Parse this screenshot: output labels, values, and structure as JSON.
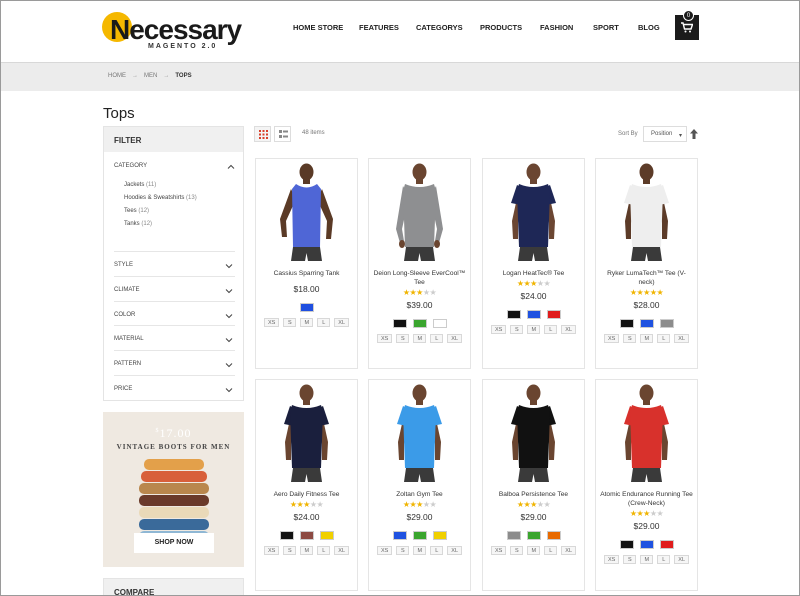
{
  "brand": {
    "logo_text": "Necessary",
    "logo_sub": "MAGENTO 2.0"
  },
  "nav": [
    "HOME STORE",
    "FEATURES",
    "CATEGORYS",
    "PRODUCTS",
    "FASHION",
    "SPORT",
    "BLOG"
  ],
  "cart": {
    "count": "0"
  },
  "breadcrumb": {
    "items": [
      "HOME",
      "MEN"
    ],
    "current": "TOPS"
  },
  "page": {
    "title": "Tops"
  },
  "filter": {
    "title": "FILTER",
    "category_label": "CATEGORY",
    "categories": [
      {
        "label": "Jackets",
        "count": "(11)"
      },
      {
        "label": "Hoodies & Sweatshirts",
        "count": "(13)"
      },
      {
        "label": "Tees",
        "count": "(12)"
      },
      {
        "label": "Tanks",
        "count": "(12)"
      }
    ],
    "sections": [
      "STYLE",
      "CLIMATE",
      "COLOR",
      "MATERIAL",
      "PATTERN",
      "PRICE"
    ]
  },
  "banner": {
    "price_symbol": "$",
    "price": "17.00",
    "tagline": "VINTAGE BOOTS FOR MEN",
    "button": "SHOP NOW"
  },
  "compare": {
    "title": "COMPARE"
  },
  "toolbar": {
    "items": "48 items",
    "sort_label": "Sort By",
    "sort_value": "Position"
  },
  "products": [
    {
      "name": "Cassius Sparring Tank",
      "rating": 0,
      "price": "$18.00",
      "colors": [
        "#1f4fe0"
      ],
      "sizes": [
        "XS",
        "S",
        "M",
        "L",
        "XL"
      ],
      "shirt": "#4f66d6",
      "sleeve": "tank",
      "skin": "#5a3a26"
    },
    {
      "name": "Deion Long-Sleeve EverCool™ Tee",
      "rating": 3,
      "price": "$39.00",
      "colors": [
        "#111111",
        "#3aa52e",
        "#ffffff"
      ],
      "sizes": [
        "XS",
        "S",
        "M",
        "L",
        "XL"
      ],
      "shirt": "#8e8f91",
      "sleeve": "long",
      "skin": "#6a4530"
    },
    {
      "name": "Logan HeatTec® Tee",
      "rating": 3,
      "price": "$24.00",
      "colors": [
        "#111111",
        "#1f52e0",
        "#e01c1c"
      ],
      "sizes": [
        "XS",
        "S",
        "M",
        "L",
        "XL"
      ],
      "shirt": "#1e2756",
      "sleeve": "short",
      "skin": "#6b4632"
    },
    {
      "name": "Ryker LumaTech™ Tee (V-neck)",
      "rating": 5,
      "price": "$28.00",
      "colors": [
        "#111111",
        "#1f52e0",
        "#8c8c8c"
      ],
      "sizes": [
        "XS",
        "S",
        "M",
        "L",
        "XL"
      ],
      "shirt": "#eeeeee",
      "sleeve": "short",
      "skin": "#5c3b28"
    },
    {
      "name": "Aero Daily Fitness Tee",
      "rating": 3,
      "price": "$24.00",
      "colors": [
        "#111111",
        "#8c4a42",
        "#f0d000"
      ],
      "sizes": [
        "XS",
        "S",
        "M",
        "L",
        "XL"
      ],
      "shirt": "#1a1f3d",
      "sleeve": "short",
      "skin": "#6a4530"
    },
    {
      "name": "Zoltan Gym Tee",
      "rating": 3,
      "price": "$29.00",
      "colors": [
        "#1f52e0",
        "#3aa52e",
        "#f0d000"
      ],
      "sizes": [
        "XS",
        "S",
        "M",
        "L",
        "XL"
      ],
      "shirt": "#3b9be8",
      "sleeve": "short",
      "skin": "#6a4530"
    },
    {
      "name": "Balboa Persistence Tee",
      "rating": 3,
      "price": "$29.00",
      "colors": [
        "#8c8c8c",
        "#3aa52e",
        "#e86a00"
      ],
      "sizes": [
        "XS",
        "S",
        "M",
        "L",
        "XL"
      ],
      "shirt": "#111111",
      "sleeve": "short",
      "skin": "#6a4530"
    },
    {
      "name": "Atomic Endurance Running Tee (Crew-Neck)",
      "rating": 3,
      "price": "$29.00",
      "colors": [
        "#111111",
        "#1f52e0",
        "#e01c1c"
      ],
      "sizes": [
        "XS",
        "S",
        "M",
        "L",
        "XL"
      ],
      "shirt": "#d8312c",
      "sleeve": "short",
      "skin": "#6a4530"
    }
  ]
}
